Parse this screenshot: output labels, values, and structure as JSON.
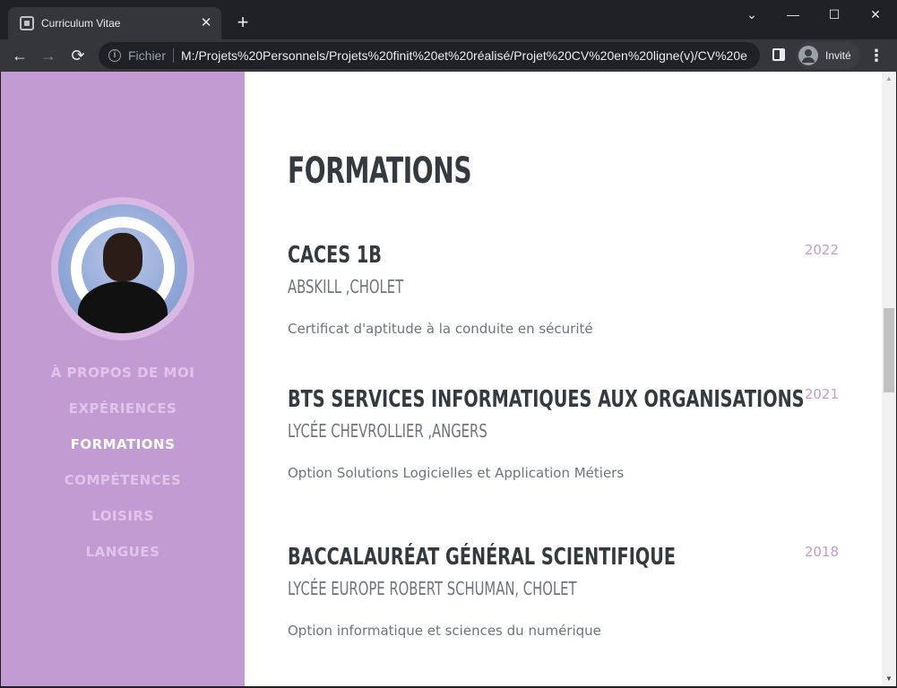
{
  "browser": {
    "tab_title": "Curriculum Vitae",
    "tab_close_glyph": "✕",
    "new_tab_glyph": "+",
    "address_prefix": "Fichier",
    "url": "M:/Projets%20Personnels/Projets%20finit%20et%20réalisé/Projet%20CV%20en%20ligne(v)/CV%20e...",
    "profile_label": "Invité",
    "window_controls": [
      "⌄",
      "—",
      "☐",
      "✕"
    ]
  },
  "sidebar": {
    "nav": [
      {
        "label": "À PROPOS DE MOI",
        "active": false
      },
      {
        "label": "EXPÉRIENCES",
        "active": false
      },
      {
        "label": "FORMATIONS",
        "active": true
      },
      {
        "label": "COMPÉTENCES",
        "active": false
      },
      {
        "label": "LOISIRS",
        "active": false
      },
      {
        "label": "LANGUES",
        "active": false
      }
    ]
  },
  "main": {
    "section_title": "FORMATIONS",
    "entries": [
      {
        "title": "CACES 1B",
        "subtitle": "ABSKILL ,CHOLET",
        "description": "Certificat d'aptitude à la conduite en sécurité",
        "year": "2022"
      },
      {
        "title": "BTS SERVICES INFORMATIQUES AUX ORGANISATIONS",
        "subtitle": "LYCÉE CHEVROLLIER ,ANGERS",
        "description": "Option Solutions Logicielles et Application Métiers",
        "year": "2021"
      },
      {
        "title": "BACCALAURÉAT GÉNÉRAL SCIENTIFIQUE",
        "subtitle": "LYCÉE EUROPE ROBERT SCHUMAN, CHOLET",
        "description": "Option informatique et sciences du numérique",
        "year": "2018"
      }
    ]
  },
  "colors": {
    "sidebar": "#c39bd3",
    "accent": "#c39bd3",
    "heading": "#343a40",
    "muted": "#6c757d"
  }
}
